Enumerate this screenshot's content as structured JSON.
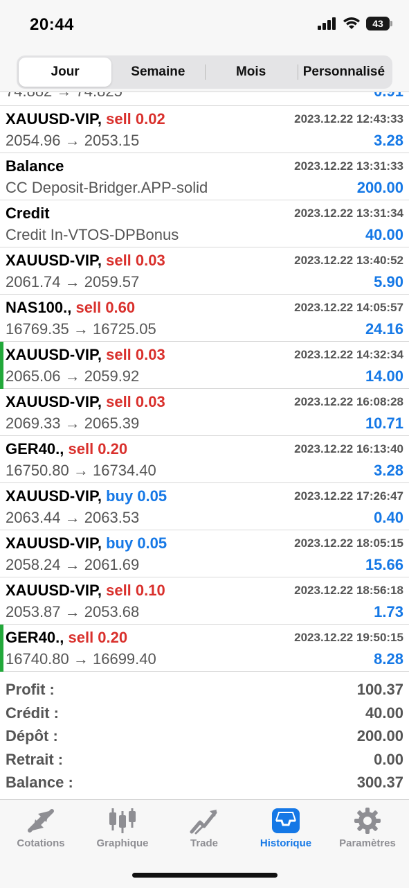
{
  "status": {
    "time": "20:44",
    "battery": "43"
  },
  "segments": [
    "Jour",
    "Semaine",
    "Mois",
    "Personnalisé"
  ],
  "partial_row": {
    "left": "74.882 → 74.825",
    "right": "0.91"
  },
  "trades": [
    {
      "symbol": "XAUUSD-VIP,",
      "action": "sell 0.02",
      "side": "sell",
      "date": "2023.12.22 12:43:33",
      "desc": "2054.96 → 2053.15",
      "amount": "3.28"
    },
    {
      "symbol": "Balance",
      "action": "",
      "side": "",
      "date": "2023.12.22 13:31:33",
      "desc": "CC Deposit-Bridger.APP-solid",
      "amount": "200.00"
    },
    {
      "symbol": "Credit",
      "action": "",
      "side": "",
      "date": "2023.12.22 13:31:34",
      "desc": "Credit In-VTOS-DPBonus",
      "amount": "40.00"
    },
    {
      "symbol": "XAUUSD-VIP,",
      "action": "sell 0.03",
      "side": "sell",
      "date": "2023.12.22 13:40:52",
      "desc": "2061.74 → 2059.57",
      "amount": "5.90"
    },
    {
      "symbol": "NAS100.,",
      "action": "sell 0.60",
      "side": "sell",
      "date": "2023.12.22 14:05:57",
      "desc": "16769.35 → 16725.05",
      "amount": "24.16"
    },
    {
      "symbol": "XAUUSD-VIP,",
      "action": "sell 0.03",
      "side": "sell",
      "date": "2023.12.22 14:32:34",
      "desc": "2065.06 → 2059.92",
      "amount": "14.00",
      "marked": true
    },
    {
      "symbol": "XAUUSD-VIP,",
      "action": "sell 0.03",
      "side": "sell",
      "date": "2023.12.22 16:08:28",
      "desc": "2069.33 → 2065.39",
      "amount": "10.71"
    },
    {
      "symbol": "GER40.,",
      "action": "sell 0.20",
      "side": "sell",
      "date": "2023.12.22 16:13:40",
      "desc": "16750.80 → 16734.40",
      "amount": "3.28"
    },
    {
      "symbol": "XAUUSD-VIP,",
      "action": "buy 0.05",
      "side": "buy",
      "date": "2023.12.22 17:26:47",
      "desc": "2063.44 → 2063.53",
      "amount": "0.40"
    },
    {
      "symbol": "XAUUSD-VIP,",
      "action": "buy 0.05",
      "side": "buy",
      "date": "2023.12.22 18:05:15",
      "desc": "2058.24 → 2061.69",
      "amount": "15.66"
    },
    {
      "symbol": "XAUUSD-VIP,",
      "action": "sell 0.10",
      "side": "sell",
      "date": "2023.12.22 18:56:18",
      "desc": "2053.87 → 2053.68",
      "amount": "1.73"
    },
    {
      "symbol": "GER40.,",
      "action": "sell 0.20",
      "side": "sell",
      "date": "2023.12.22 19:50:15",
      "desc": "16740.80 → 16699.40",
      "amount": "8.28",
      "marked": true
    }
  ],
  "summary": [
    {
      "label": "Profit :",
      "value": "100.37"
    },
    {
      "label": "Crédit :",
      "value": "40.00"
    },
    {
      "label": "Dépôt :",
      "value": "200.00"
    },
    {
      "label": "Retrait :",
      "value": "0.00"
    },
    {
      "label": "Balance :",
      "value": "300.37"
    }
  ],
  "tabs": [
    {
      "label": "Cotations",
      "icon": "quotes-arrows-icon"
    },
    {
      "label": "Graphique",
      "icon": "candlestick-chart-icon"
    },
    {
      "label": "Trade",
      "icon": "trade-trend-icon"
    },
    {
      "label": "Historique",
      "icon": "history-inbox-icon",
      "active": true
    },
    {
      "label": "Paramètres",
      "icon": "settings-gear-icon"
    }
  ],
  "colors": {
    "sell": "#d9302c",
    "buy": "#1578e6",
    "amount": "#1578e6",
    "marker": "#22a83a",
    "tab_active": "#1578e6",
    "tab_inactive": "#8e8e93"
  }
}
